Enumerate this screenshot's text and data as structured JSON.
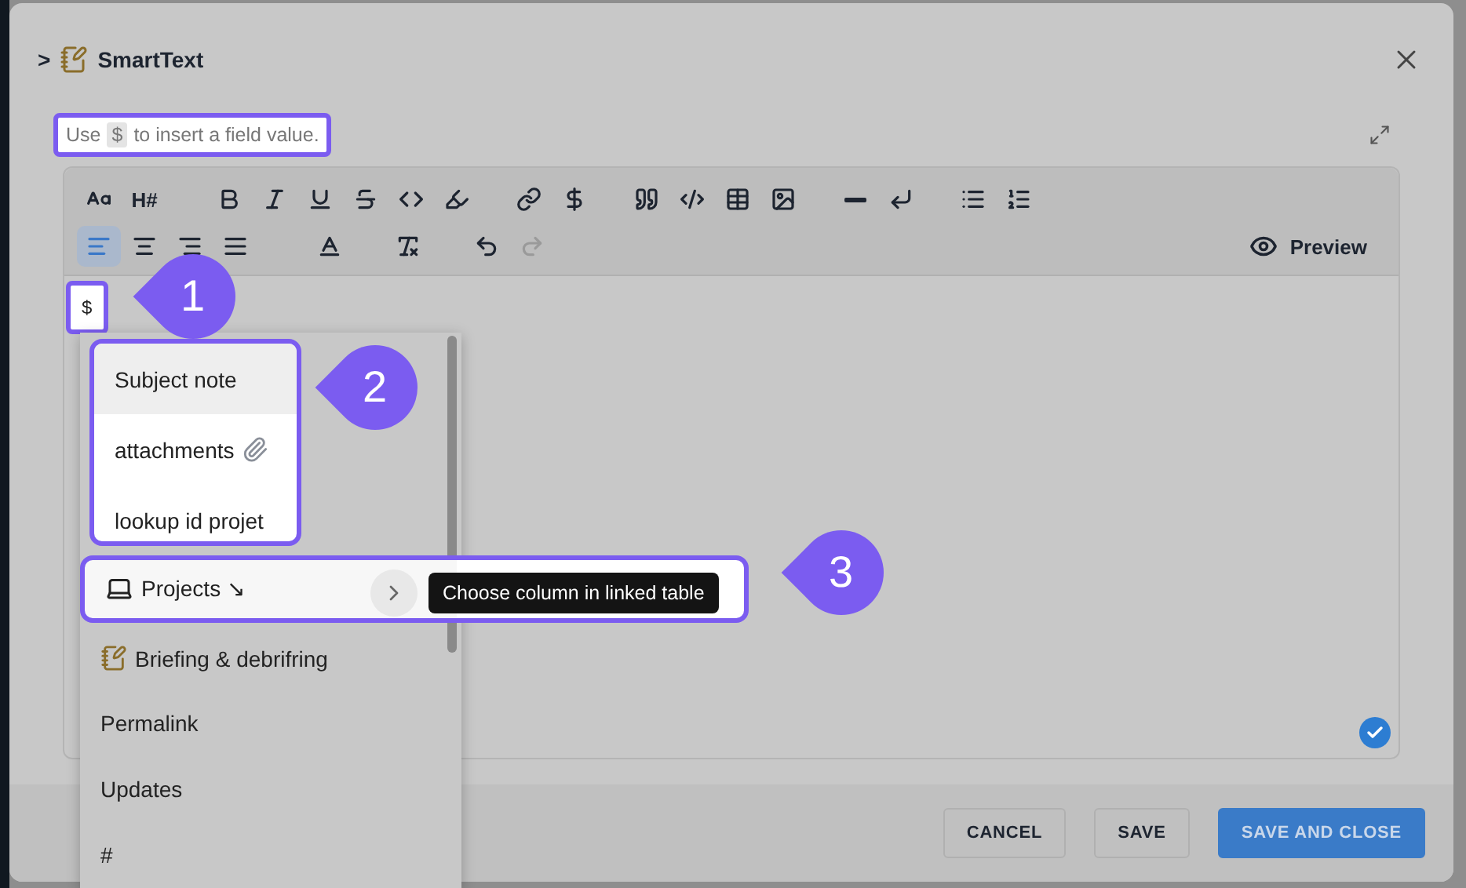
{
  "dialog": {
    "breadcrumb": ">",
    "title": "SmartText"
  },
  "hint": {
    "before": "Use",
    "token": "$",
    "after": "to insert a field value.",
    "highlighted": true
  },
  "toolbar": {
    "heading_label": "H#",
    "alignment": [
      {
        "selected": true
      },
      {
        "selected": false
      },
      {
        "selected": false
      },
      {
        "selected": false
      }
    ],
    "history": [
      {
        "disabled": false
      },
      {
        "disabled": true
      }
    ],
    "preview": "Preview"
  },
  "content": {
    "text": "$",
    "highlighted": true
  },
  "dropdown": {
    "items": [
      {
        "label": "Subject note",
        "kind": "field",
        "selected": true,
        "highlighted": true
      },
      {
        "label": "attachments",
        "kind": "attachment",
        "selected": false,
        "highlighted": true
      },
      {
        "label": "lookup id projet",
        "kind": "field",
        "selected": false,
        "highlighted": true
      },
      {
        "label": "Projects ↘",
        "kind": "linked",
        "selected": false,
        "highlighted": true,
        "tooltip": "Choose column in linked table"
      },
      {
        "label": "Briefing & debrifring",
        "kind": "note",
        "selected": false,
        "highlighted": false
      },
      {
        "label": "Permalink",
        "kind": "field",
        "selected": false,
        "highlighted": false
      },
      {
        "label": "Updates",
        "kind": "field",
        "selected": false,
        "highlighted": false
      },
      {
        "label": "#",
        "kind": "field",
        "selected": false,
        "highlighted": false
      }
    ]
  },
  "footer": {
    "buttons": [
      {
        "label": "CANCEL",
        "kind": "secondary"
      },
      {
        "label": "SAVE",
        "kind": "secondary"
      },
      {
        "label": "SAVE AND CLOSE",
        "kind": "primary"
      }
    ]
  },
  "annotations": [
    {
      "label": "1"
    },
    {
      "label": "2"
    },
    {
      "label": "3"
    }
  ]
}
